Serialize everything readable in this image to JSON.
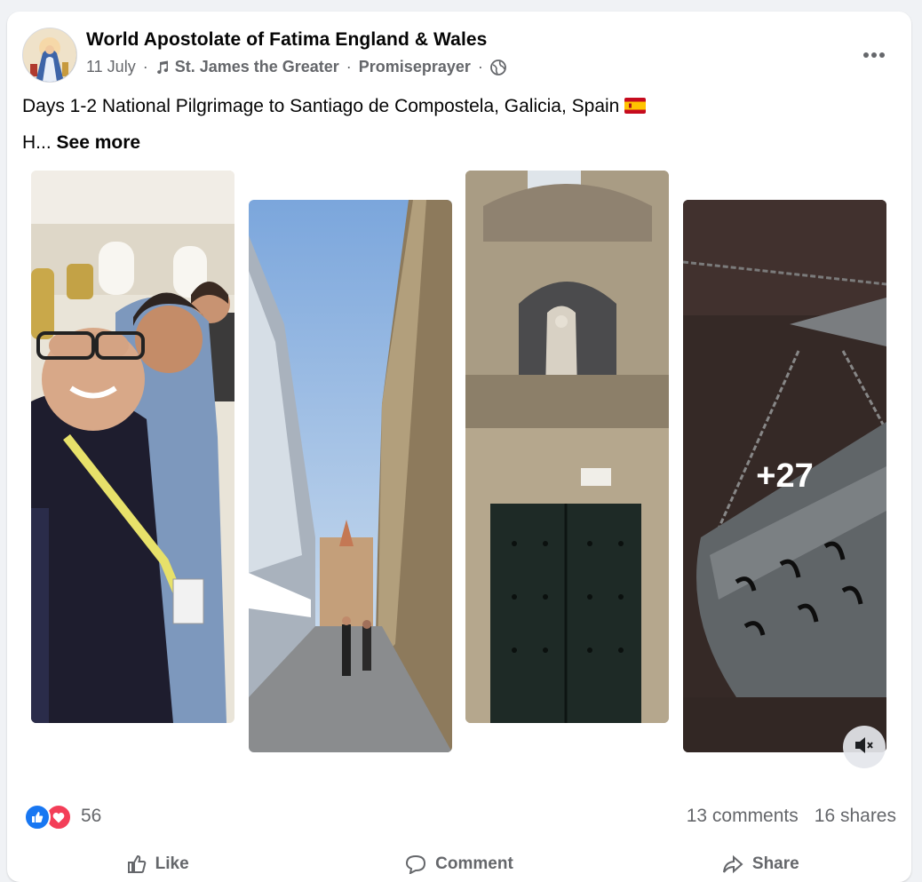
{
  "post": {
    "page_name": "World Apostolate of Fatima England & Wales",
    "date": "11 July",
    "music_track": "St. James the Greater",
    "music_artist": "Promiseprayer",
    "separator": "·",
    "text_line1": "Days 1-2 National Pilgrimage to Santiago de Compostela, Galicia, Spain",
    "text_line2_prefix": "H...",
    "see_more": "See more",
    "more_photos_count": "+27"
  },
  "engagement": {
    "reaction_count": "56",
    "comments": "13 comments",
    "shares": "16 shares"
  },
  "actions": {
    "like": "Like",
    "comment": "Comment",
    "share": "Share"
  },
  "colors": {
    "facebook_blue": "#1877f2",
    "love_red": "#f33e58",
    "secondary_text": "#65676b",
    "background": "#f0f2f5"
  },
  "icons": [
    "more-options-icon",
    "music-note-icon",
    "globe-icon",
    "spain-flag-icon",
    "like-reaction-icon",
    "love-reaction-icon",
    "mute-icon",
    "like-icon",
    "comment-icon",
    "share-icon"
  ]
}
